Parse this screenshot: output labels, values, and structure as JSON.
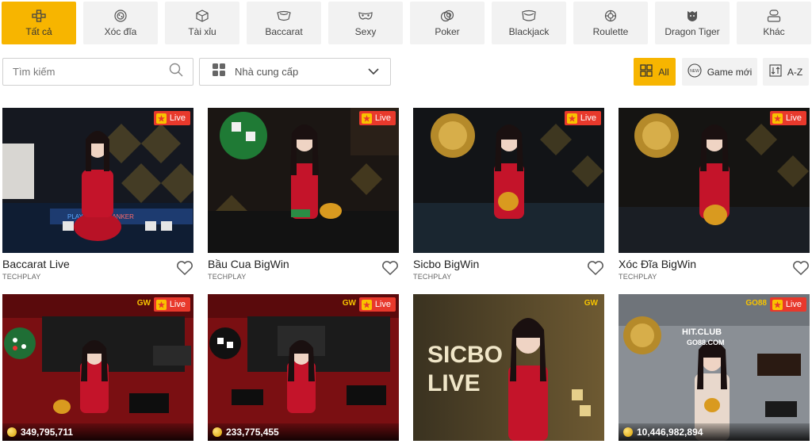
{
  "tabs": [
    {
      "label": "Tất cả",
      "icon": "all-games-icon",
      "active": true
    },
    {
      "label": "Xóc đĩa",
      "icon": "xoc-dia-icon",
      "active": false
    },
    {
      "label": "Tài xỉu",
      "icon": "dice-icon",
      "active": false
    },
    {
      "label": "Baccarat",
      "icon": "baccarat-icon",
      "active": false
    },
    {
      "label": "Sexy",
      "icon": "mask-icon",
      "active": false
    },
    {
      "label": "Poker",
      "icon": "poker-chips-icon",
      "active": false
    },
    {
      "label": "Blackjack",
      "icon": "blackjack-icon",
      "active": false
    },
    {
      "label": "Roulette",
      "icon": "roulette-icon",
      "active": false
    },
    {
      "label": "Dragon Tiger",
      "icon": "dragon-tiger-icon",
      "active": false
    },
    {
      "label": "Khác",
      "icon": "other-icon",
      "active": false
    }
  ],
  "search": {
    "placeholder": "Tìm kiếm"
  },
  "provider": {
    "label": "Nhà cung cấp"
  },
  "filters": {
    "all": "All",
    "new": "Game mới",
    "az": "A-Z"
  },
  "badge": {
    "live": "Live"
  },
  "games": [
    {
      "name": "Baccarat Live",
      "provider": "TECHPLAY",
      "live": true
    },
    {
      "name": "Bầu Cua BigWin",
      "provider": "TECHPLAY",
      "live": true
    },
    {
      "name": "Sicbo BigWin",
      "provider": "TECHPLAY",
      "live": true
    },
    {
      "name": "Xóc Đĩa BigWin",
      "provider": "TECHPLAY",
      "live": true
    },
    {
      "jackpot": "349,795,711",
      "live": true,
      "logo": "GW"
    },
    {
      "jackpot": "233,775,455",
      "live": true,
      "logo": "GW"
    },
    {
      "jackpot": "",
      "live": false,
      "logo": "GW",
      "overlay_line1": "SICBO",
      "overlay_line2": "LIVE"
    },
    {
      "jackpot": "10,446,982,894",
      "live": true,
      "logo": "GO88",
      "overlay_line1": "HIT.CLUB",
      "overlay_line2": "GO88.COM"
    }
  ],
  "colors": {
    "accent": "#f7b500",
    "live_badge": "#e8392c",
    "tab_bg": "#f2f2f2"
  }
}
